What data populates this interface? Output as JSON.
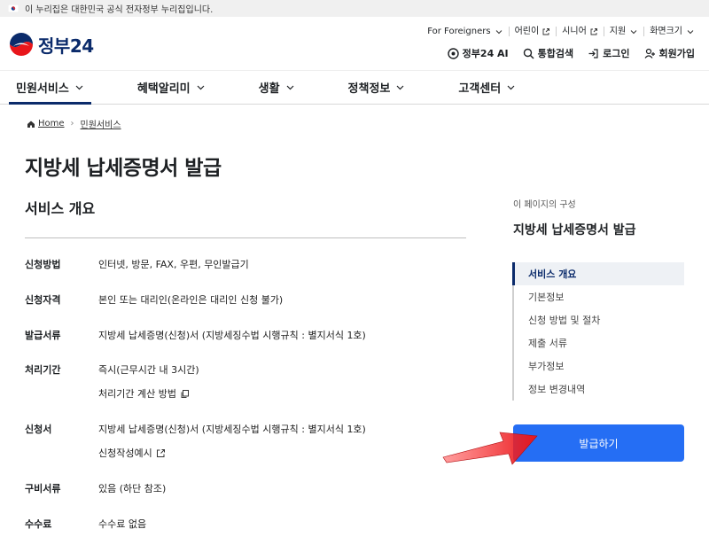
{
  "banner": {
    "text": "이 누리집은 대한민국 공식 전자정부 누리집입니다."
  },
  "logo": {
    "text": "정부",
    "num": "24"
  },
  "util_links": [
    "For Foreigners",
    "어린이",
    "시니어",
    "지원",
    "화면크기"
  ],
  "actions": {
    "ai": "정부24 AI",
    "search": "통합검색",
    "login": "로그인",
    "signup": "회원가입"
  },
  "nav": [
    "민원서비스",
    "혜택알리미",
    "생활",
    "정책정보",
    "고객센터"
  ],
  "breadcrumb": {
    "home": "Home",
    "current": "민원서비스"
  },
  "page_title": "지방세 납세증명서 발급",
  "section_title": "서비스 개요",
  "rows": [
    {
      "label": "신청방법",
      "value": "인터넷, 방문, FAX, 우편, 무인발급기"
    },
    {
      "label": "신청자격",
      "value": "본인 또는 대리인(온라인은 대리인 신청 불가)"
    },
    {
      "label": "발급서류",
      "value": "지방세 납세증명(신청)서 (지방세징수법 시행규칙 : 별지서식 1호)"
    },
    {
      "label": "처리기간",
      "value": "즉시(근무시간 내 3시간)",
      "sub": "처리기간 계산 방법"
    },
    {
      "label": "신청서",
      "value": "지방세 납세증명(신청)서 (지방세징수법 시행규칙 : 별지서식 1호)",
      "sub": "신청작성예시"
    },
    {
      "label": "구비서류",
      "value": "있음 (하단 참조)"
    },
    {
      "label": "수수료",
      "value": "수수료 없음"
    }
  ],
  "toc": {
    "caption": "이 페이지의 구성",
    "title": "지방세 납세증명서 발급",
    "items": [
      "서비스 개요",
      "기본정보",
      "신청 방법 및 절차",
      "제출 서류",
      "부가정보",
      "정보 변경내역"
    ]
  },
  "issue_button": "발급하기",
  "colors": {
    "primary": "#256ef4",
    "navy": "#0b2b6b",
    "arrow": "#e8161b"
  }
}
